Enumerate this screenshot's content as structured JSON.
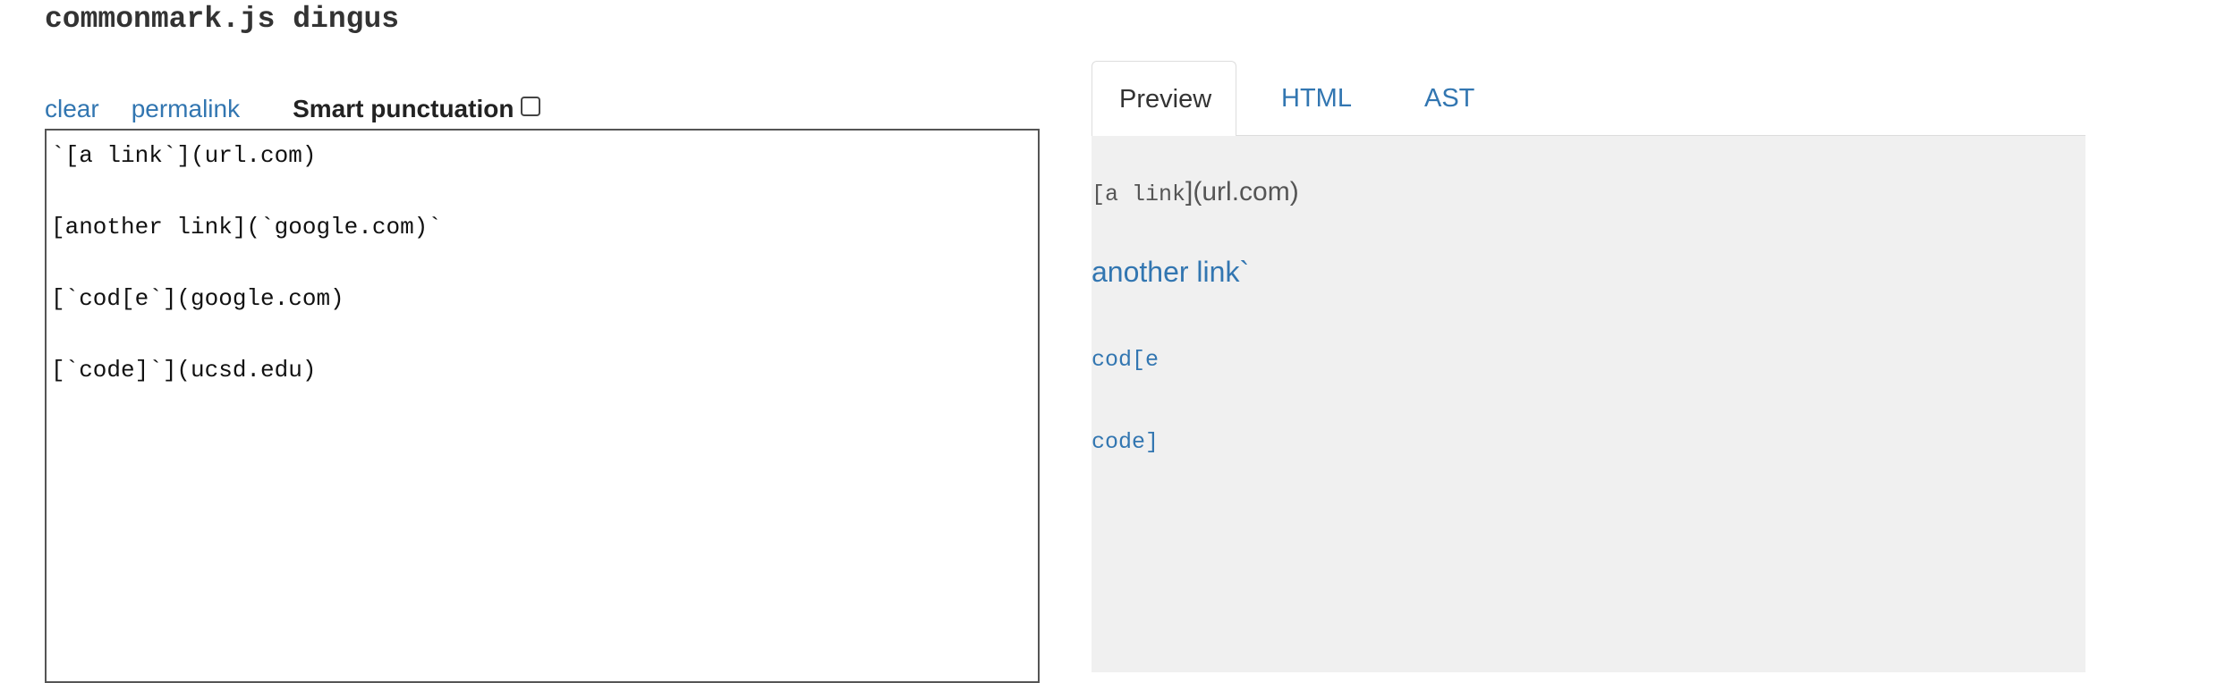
{
  "app": {
    "title": "commonmark.js dingus"
  },
  "controls": {
    "clear_label": "clear",
    "permalink_label": "permalink",
    "smart_punctuation_label": "Smart punctuation",
    "smart_punctuation_checked": false
  },
  "editor": {
    "lines": [
      "`[a link`](url.com)",
      "",
      "[another link](`google.com)`",
      "",
      "[`cod[e`](google.com)",
      "",
      "[`code]`](ucsd.edu)"
    ]
  },
  "tabs": [
    {
      "label": "Preview",
      "active": true
    },
    {
      "label": "HTML",
      "active": false
    },
    {
      "label": "AST",
      "active": false
    }
  ],
  "preview": {
    "item1_code": "[a link",
    "item1_text": "](url.com)",
    "item2_link": "another link`",
    "item3_code_link": "cod[e",
    "item4_code_link": "code]"
  },
  "colors": {
    "link": "#3276b1",
    "preview_background": "#f0f0f0",
    "editor_border": "#555555"
  }
}
